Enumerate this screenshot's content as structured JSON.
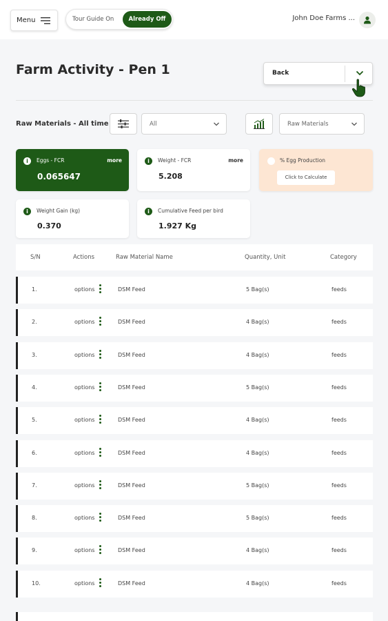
{
  "header": {
    "menu_label": "Menu",
    "tour_on_label": "Tour Guide On",
    "tour_off_label": "Already Off",
    "account_name": "John Doe Farms ..."
  },
  "page": {
    "title": "Farm Activity - Pen 1",
    "back_label": "Back"
  },
  "filters": {
    "label": "Raw Materials - All time",
    "range_value": "All",
    "type_value": "Raw Materials"
  },
  "cards": {
    "eggs_fcr": {
      "title": "Eggs - FCR",
      "more": "more",
      "value": "0.065647"
    },
    "weight_fcr": {
      "title": "Weight - FCR",
      "more": "more",
      "value": "5.208"
    },
    "egg_production": {
      "title": "% Egg Production",
      "button": "Click to Calculate"
    },
    "weight_gain": {
      "title": "Weight Gain (kg)",
      "value": "0.370"
    },
    "cumulative_feed": {
      "title": "Cumulative Feed per bird",
      "value": "1.927 Kg"
    }
  },
  "table": {
    "headers": [
      "S/N",
      "Actions",
      "Raw Material Name",
      "Quantity, Unit",
      "Category"
    ],
    "rows": [
      {
        "sn": "1.",
        "action": "options",
        "name": "DSM Feed",
        "qty": "5 Bag(s)",
        "category": "feeds"
      },
      {
        "sn": "2.",
        "action": "options",
        "name": "DSM Feed",
        "qty": "4 Bag(s)",
        "category": "feeds"
      },
      {
        "sn": "3.",
        "action": "options",
        "name": "DSM Feed",
        "qty": "4 Bag(s)",
        "category": "feeds"
      },
      {
        "sn": "4.",
        "action": "options",
        "name": "DSM Feed",
        "qty": "5 Bag(s)",
        "category": "feeds"
      },
      {
        "sn": "5.",
        "action": "options",
        "name": "DSM Feed",
        "qty": "4 Bag(s)",
        "category": "feeds"
      },
      {
        "sn": "6.",
        "action": "options",
        "name": "DSM Feed",
        "qty": "4 Bag(s)",
        "category": "feeds"
      },
      {
        "sn": "7.",
        "action": "options",
        "name": "DSM Feed",
        "qty": "5 Bag(s)",
        "category": "feeds"
      },
      {
        "sn": "8.",
        "action": "options",
        "name": "DSM Feed",
        "qty": "5 Bag(s)",
        "category": "feeds"
      },
      {
        "sn": "9.",
        "action": "options",
        "name": "DSM Feed",
        "qty": "4 Bag(s)",
        "category": "feeds"
      },
      {
        "sn": "10.",
        "action": "options",
        "name": "DSM Feed",
        "qty": "4 Bag(s)",
        "category": "feeds"
      }
    ]
  },
  "colors": {
    "brand_green": "#1e5a17",
    "peach_card": "#fde6d3",
    "page_bg": "#f5f6f8"
  },
  "icons": {
    "menu": "hamburger-icon",
    "avatar": "user-icon",
    "back_chevron": "chevron-down-icon",
    "filter": "sliders-icon",
    "chart": "bar-chart-icon",
    "info": "info-icon",
    "row_actions": "kebab-icon"
  }
}
